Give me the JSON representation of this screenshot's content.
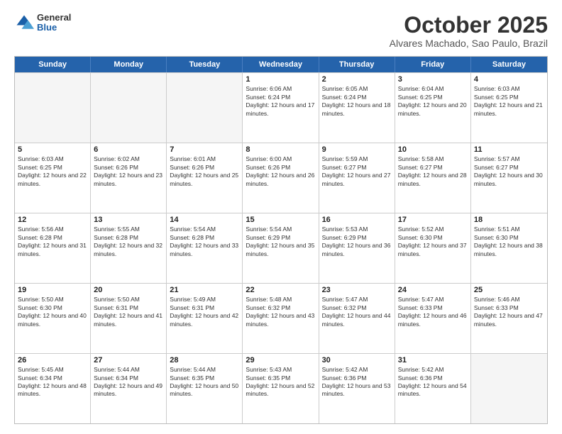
{
  "logo": {
    "general": "General",
    "blue": "Blue"
  },
  "title": "October 2025",
  "subtitle": "Alvares Machado, Sao Paulo, Brazil",
  "header": {
    "days": [
      "Sunday",
      "Monday",
      "Tuesday",
      "Wednesday",
      "Thursday",
      "Friday",
      "Saturday"
    ]
  },
  "weeks": [
    [
      {
        "day": "",
        "empty": true
      },
      {
        "day": "",
        "empty": true
      },
      {
        "day": "",
        "empty": true
      },
      {
        "day": "1",
        "sunrise": "6:06 AM",
        "sunset": "6:24 PM",
        "daylight": "12 hours and 17 minutes."
      },
      {
        "day": "2",
        "sunrise": "6:05 AM",
        "sunset": "6:24 PM",
        "daylight": "12 hours and 18 minutes."
      },
      {
        "day": "3",
        "sunrise": "6:04 AM",
        "sunset": "6:25 PM",
        "daylight": "12 hours and 20 minutes."
      },
      {
        "day": "4",
        "sunrise": "6:03 AM",
        "sunset": "6:25 PM",
        "daylight": "12 hours and 21 minutes."
      }
    ],
    [
      {
        "day": "5",
        "sunrise": "6:03 AM",
        "sunset": "6:25 PM",
        "daylight": "12 hours and 22 minutes."
      },
      {
        "day": "6",
        "sunrise": "6:02 AM",
        "sunset": "6:26 PM",
        "daylight": "12 hours and 23 minutes."
      },
      {
        "day": "7",
        "sunrise": "6:01 AM",
        "sunset": "6:26 PM",
        "daylight": "12 hours and 25 minutes."
      },
      {
        "day": "8",
        "sunrise": "6:00 AM",
        "sunset": "6:26 PM",
        "daylight": "12 hours and 26 minutes."
      },
      {
        "day": "9",
        "sunrise": "5:59 AM",
        "sunset": "6:27 PM",
        "daylight": "12 hours and 27 minutes."
      },
      {
        "day": "10",
        "sunrise": "5:58 AM",
        "sunset": "6:27 PM",
        "daylight": "12 hours and 28 minutes."
      },
      {
        "day": "11",
        "sunrise": "5:57 AM",
        "sunset": "6:27 PM",
        "daylight": "12 hours and 30 minutes."
      }
    ],
    [
      {
        "day": "12",
        "sunrise": "5:56 AM",
        "sunset": "6:28 PM",
        "daylight": "12 hours and 31 minutes."
      },
      {
        "day": "13",
        "sunrise": "5:55 AM",
        "sunset": "6:28 PM",
        "daylight": "12 hours and 32 minutes."
      },
      {
        "day": "14",
        "sunrise": "5:54 AM",
        "sunset": "6:28 PM",
        "daylight": "12 hours and 33 minutes."
      },
      {
        "day": "15",
        "sunrise": "5:54 AM",
        "sunset": "6:29 PM",
        "daylight": "12 hours and 35 minutes."
      },
      {
        "day": "16",
        "sunrise": "5:53 AM",
        "sunset": "6:29 PM",
        "daylight": "12 hours and 36 minutes."
      },
      {
        "day": "17",
        "sunrise": "5:52 AM",
        "sunset": "6:30 PM",
        "daylight": "12 hours and 37 minutes."
      },
      {
        "day": "18",
        "sunrise": "5:51 AM",
        "sunset": "6:30 PM",
        "daylight": "12 hours and 38 minutes."
      }
    ],
    [
      {
        "day": "19",
        "sunrise": "5:50 AM",
        "sunset": "6:30 PM",
        "daylight": "12 hours and 40 minutes."
      },
      {
        "day": "20",
        "sunrise": "5:50 AM",
        "sunset": "6:31 PM",
        "daylight": "12 hours and 41 minutes."
      },
      {
        "day": "21",
        "sunrise": "5:49 AM",
        "sunset": "6:31 PM",
        "daylight": "12 hours and 42 minutes."
      },
      {
        "day": "22",
        "sunrise": "5:48 AM",
        "sunset": "6:32 PM",
        "daylight": "12 hours and 43 minutes."
      },
      {
        "day": "23",
        "sunrise": "5:47 AM",
        "sunset": "6:32 PM",
        "daylight": "12 hours and 44 minutes."
      },
      {
        "day": "24",
        "sunrise": "5:47 AM",
        "sunset": "6:33 PM",
        "daylight": "12 hours and 46 minutes."
      },
      {
        "day": "25",
        "sunrise": "5:46 AM",
        "sunset": "6:33 PM",
        "daylight": "12 hours and 47 minutes."
      }
    ],
    [
      {
        "day": "26",
        "sunrise": "5:45 AM",
        "sunset": "6:34 PM",
        "daylight": "12 hours and 48 minutes."
      },
      {
        "day": "27",
        "sunrise": "5:44 AM",
        "sunset": "6:34 PM",
        "daylight": "12 hours and 49 minutes."
      },
      {
        "day": "28",
        "sunrise": "5:44 AM",
        "sunset": "6:35 PM",
        "daylight": "12 hours and 50 minutes."
      },
      {
        "day": "29",
        "sunrise": "5:43 AM",
        "sunset": "6:35 PM",
        "daylight": "12 hours and 52 minutes."
      },
      {
        "day": "30",
        "sunrise": "5:42 AM",
        "sunset": "6:36 PM",
        "daylight": "12 hours and 53 minutes."
      },
      {
        "day": "31",
        "sunrise": "5:42 AM",
        "sunset": "6:36 PM",
        "daylight": "12 hours and 54 minutes."
      },
      {
        "day": "",
        "empty": true
      }
    ]
  ],
  "labels": {
    "sunrise": "Sunrise:",
    "sunset": "Sunset:",
    "daylight": "Daylight:"
  }
}
